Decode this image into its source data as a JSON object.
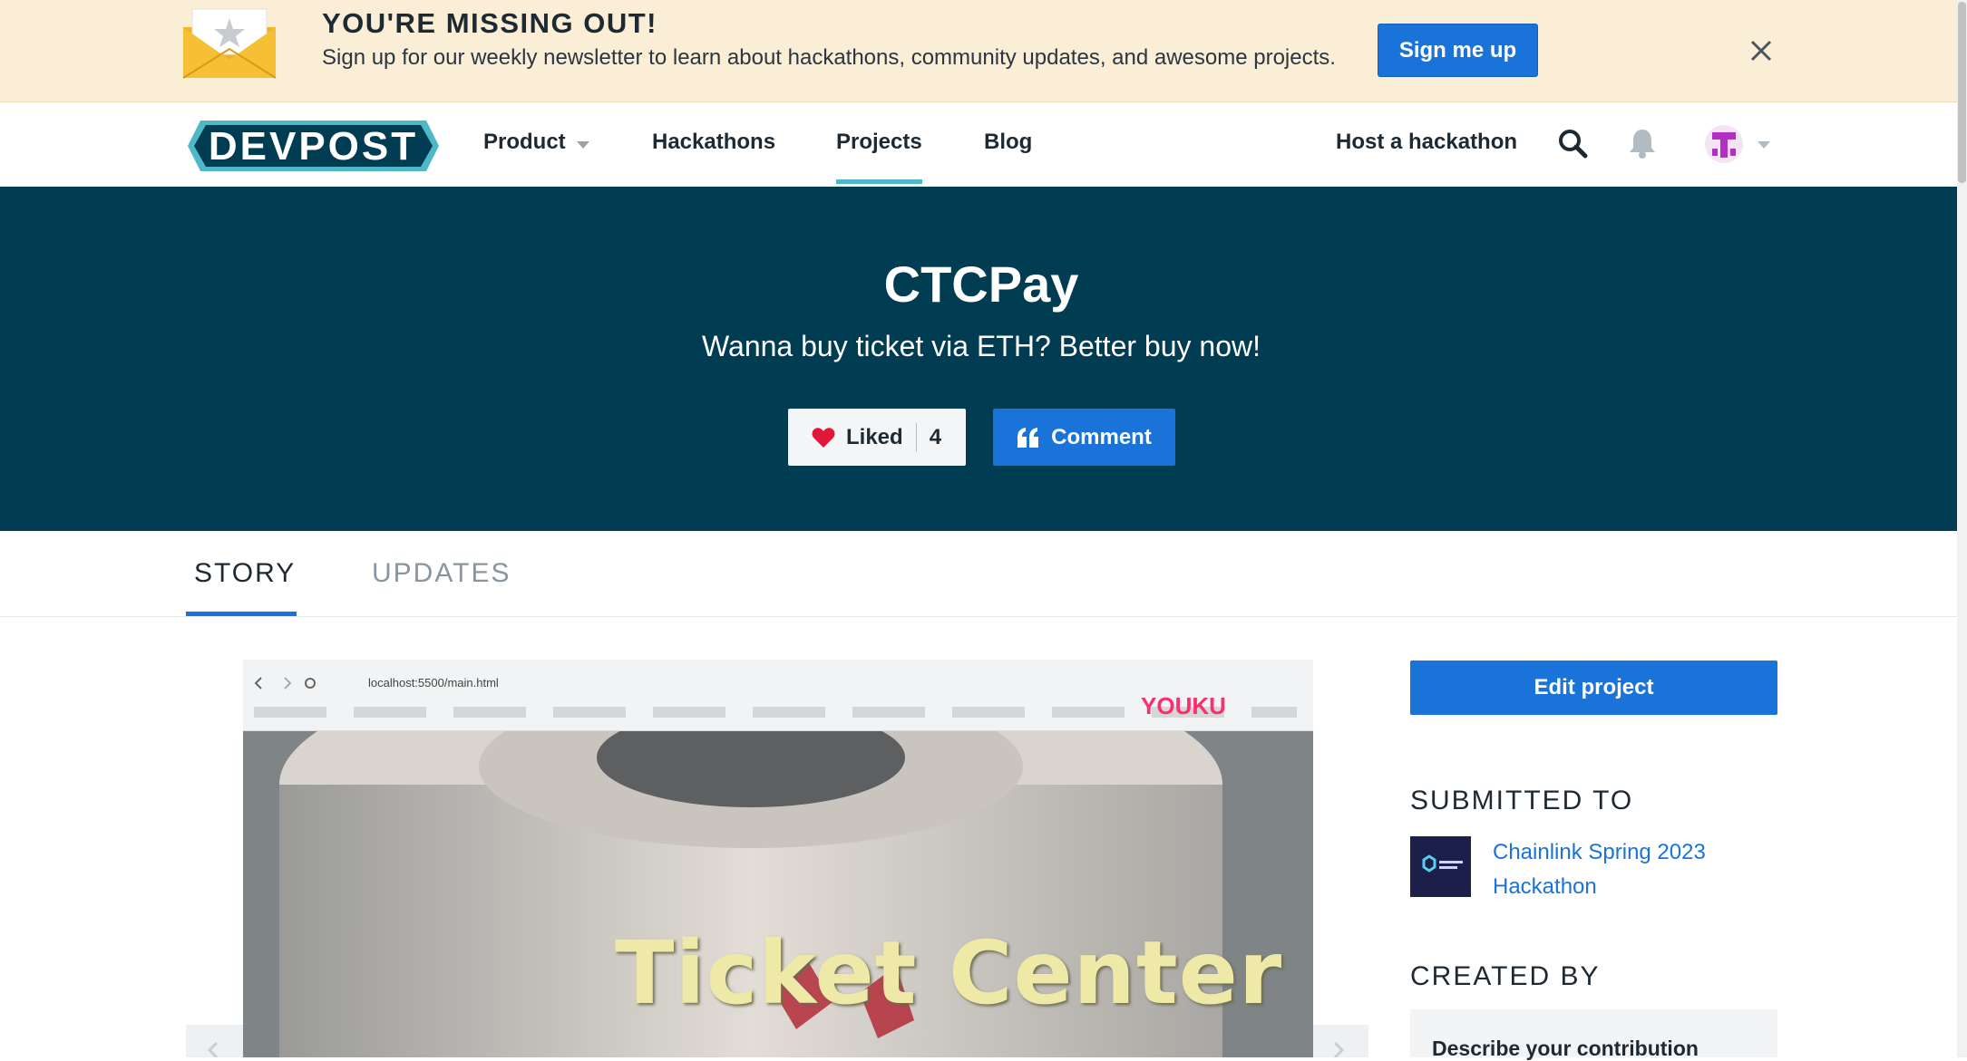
{
  "banner": {
    "title": "YOU'RE MISSING OUT!",
    "subtitle": "Sign up for our weekly newsletter to learn about hackathons, community updates, and awesome projects.",
    "signup_label": "Sign me up",
    "close_icon": "close-icon"
  },
  "nav": {
    "logo": "DEVPOST",
    "items": [
      {
        "label": "Product"
      },
      {
        "label": "Hackathons"
      },
      {
        "label": "Projects"
      },
      {
        "label": "Blog"
      }
    ],
    "host_label": "Host a hackathon",
    "active_item": "Projects"
  },
  "hero": {
    "name": "CTCPay",
    "tagline": "Wanna buy ticket via ETH? Better buy now!",
    "like_label": "Liked",
    "like_count": "4",
    "comment_label": "Comment"
  },
  "tabs": [
    {
      "label": "STORY",
      "active": true
    },
    {
      "label": "UPDATES",
      "active": false
    }
  ],
  "media": {
    "url": "localhost:5500/main.html",
    "watermark": "YOUKU",
    "overlay_text": "Ticket Center"
  },
  "sidebar": {
    "edit_label": "Edit project",
    "submitted_heading": "SUBMITTED TO",
    "hackathon": "Chainlink Spring 2023 Hackathon",
    "created_heading": "CREATED BY",
    "contribution_label": "Describe your contribution"
  },
  "colors": {
    "brand_dark": "#003c52",
    "primary_blue": "#1a73d9",
    "banner_bg": "#fbeed6",
    "accent_teal": "#4fb8c8"
  }
}
